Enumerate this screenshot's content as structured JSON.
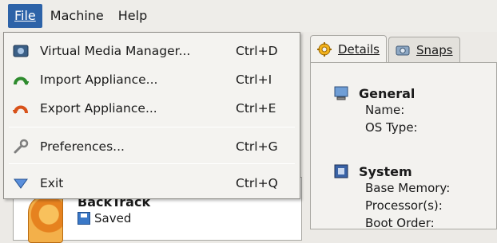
{
  "menubar": {
    "items": [
      {
        "label": "File",
        "active": true
      },
      {
        "label": "Machine",
        "active": false
      },
      {
        "label": "Help",
        "active": false
      }
    ]
  },
  "file_menu": {
    "items": [
      {
        "label": "Virtual Media Manager...",
        "shortcut": "Ctrl+D",
        "icon": "virtual-media-manager-icon"
      },
      {
        "label": "Import Appliance...",
        "shortcut": "Ctrl+I",
        "icon": "import-appliance-icon"
      },
      {
        "label": "Export Appliance...",
        "shortcut": "Ctrl+E",
        "icon": "export-appliance-icon"
      },
      {
        "label": "Preferences...",
        "shortcut": "Ctrl+G",
        "icon": "wrench-icon"
      },
      {
        "label": "Exit",
        "shortcut": "Ctrl+Q",
        "icon": "exit-arrow-icon"
      }
    ]
  },
  "vm_list": {
    "entry": {
      "name": "BackTrack",
      "state": "Saved"
    }
  },
  "details_tabs": [
    {
      "label": "Details",
      "active": true,
      "icon": "gear-icon"
    },
    {
      "label": "Snaps",
      "active": false,
      "icon": "camera-icon"
    }
  ],
  "details": {
    "general": {
      "title": "General",
      "rows": [
        "Name:",
        "OS Type:"
      ]
    },
    "system": {
      "title": "System",
      "rows": [
        "Base Memory:",
        "Processor(s):",
        "Boot Order:"
      ]
    }
  },
  "colors": {
    "menu_highlight": "#2d63a8",
    "accent_blue": "#3a78c7",
    "accent_orange": "#e6821f"
  }
}
